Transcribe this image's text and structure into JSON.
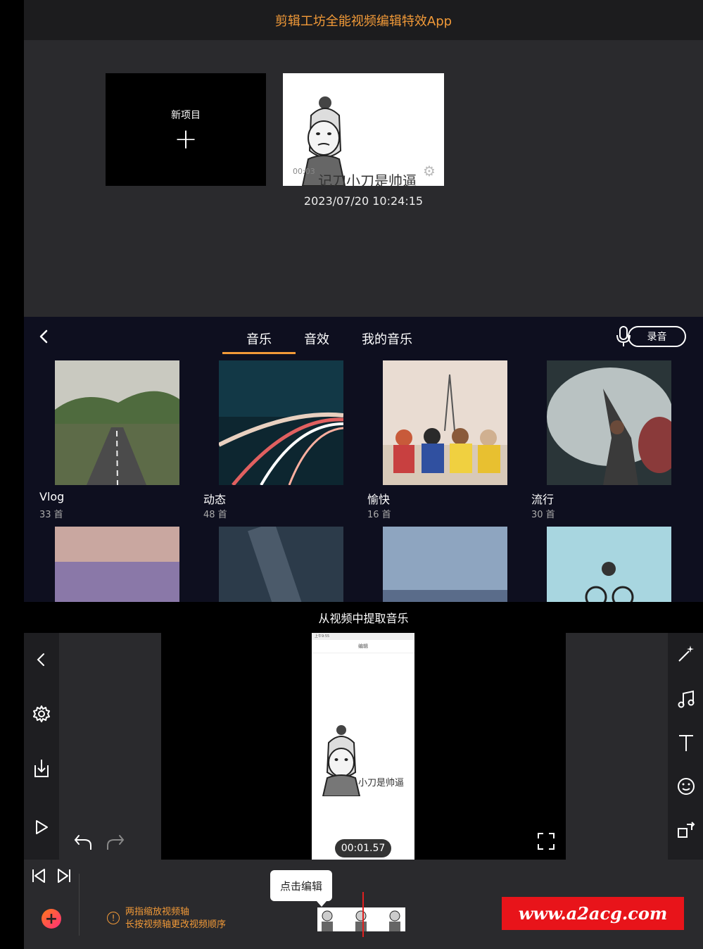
{
  "app": {
    "title": "剪辑工坊全能视频编辑特效App"
  },
  "projects": {
    "new_label": "新项目",
    "plus_symbol": "+",
    "items": [
      {
        "duration": "00:03",
        "caption": "记刀小刀是帅逼",
        "date": "2023/07/20 10:24:15"
      }
    ]
  },
  "music": {
    "tabs": [
      {
        "label": "音乐",
        "active": true
      },
      {
        "label": "音效",
        "active": false
      },
      {
        "label": "我的音乐",
        "active": false
      }
    ],
    "record_label": "录音",
    "categories": [
      {
        "name": "Vlog",
        "count": "33 首"
      },
      {
        "name": "动态",
        "count": "48 首"
      },
      {
        "name": "愉快",
        "count": "16 首"
      },
      {
        "name": "流行",
        "count": "30 首"
      },
      {
        "name": "",
        "count": ""
      },
      {
        "name": "",
        "count": ""
      },
      {
        "name": "",
        "count": ""
      },
      {
        "name": "",
        "count": ""
      }
    ]
  },
  "editor": {
    "title": "从视频中提取音乐",
    "phone_status": "上午9:55",
    "phone_title": "编辑",
    "phone_caption": "小刀是帅逼",
    "timecode": "00:01.57",
    "tooltip": "点击编辑",
    "hint_line1": "两指缩放视频轴",
    "hint_line2": "长按视频轴更改视频顺序",
    "add_symbol": "+",
    "left_tools": [
      "back-icon",
      "settings-icon",
      "export-icon",
      "play-icon"
    ],
    "right_tools": [
      "magic-wand-icon",
      "music-note-icon",
      "text-icon",
      "emoji-icon",
      "crop-icon"
    ]
  },
  "watermark": {
    "text": "www.a2acg.com"
  },
  "colors": {
    "accent": "#f29a38",
    "header_bg": "#1c1c1e",
    "panel_bg": "#2a2a2d",
    "music_bg": "#0e0f1f",
    "playhead": "#e02020",
    "watermark_bg": "#e8141a"
  }
}
